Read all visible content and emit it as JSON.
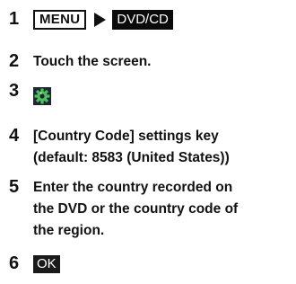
{
  "steps": [
    {
      "number": "1",
      "menu_key": "MENU",
      "dvd_key": "DVD/CD"
    },
    {
      "number": "2",
      "text": "Touch the screen."
    },
    {
      "number": "3",
      "icon": "gear-settings-icon"
    },
    {
      "number": "4",
      "line1": "[Country Code] settings key",
      "line2": "(default: 8583 (United States))"
    },
    {
      "number": "5",
      "line1": "Enter the country recorded on",
      "line2": "the DVD or the country code of",
      "line3": "the region."
    },
    {
      "number": "6",
      "ok_key": "OK"
    }
  ],
  "colors": {
    "text": "#111111",
    "key_background": "#0a0a0a",
    "key_text": "#ffffff",
    "gear_green": "#4fbf5a",
    "gear_background": "#1c2733"
  }
}
